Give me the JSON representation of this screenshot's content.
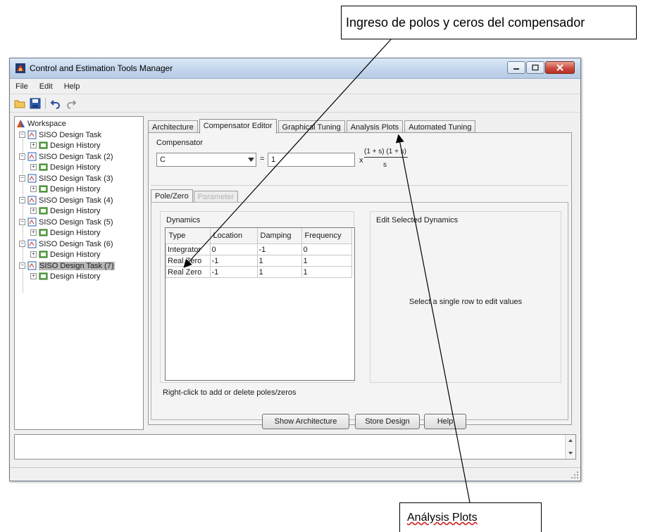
{
  "annotations": {
    "top": "Ingreso de polos y ceros del compensador",
    "bottom": "Análysis Plots"
  },
  "window": {
    "title": "Control and Estimation Tools Manager"
  },
  "menu": [
    "File",
    "Edit",
    "Help"
  ],
  "toolbar": {
    "icons": [
      "open-folder-icon",
      "save-icon",
      "undo-icon",
      "redo-icon"
    ]
  },
  "tree": {
    "root": "Workspace",
    "tasks": [
      {
        "label": "SISO Design Task",
        "child": "Design History"
      },
      {
        "label": "SISO Design Task (2)",
        "child": "Design History"
      },
      {
        "label": "SISO Design Task (3)",
        "child": "Design History"
      },
      {
        "label": "SISO Design Task (4)",
        "child": "Design History"
      },
      {
        "label": "SISO Design Task (5)",
        "child": "Design History"
      },
      {
        "label": "SISO Design Task (6)",
        "child": "Design History"
      },
      {
        "label": "SISO Design Task (7)",
        "child": "Design History",
        "selected": true
      }
    ]
  },
  "tabs": [
    "Architecture",
    "Compensator Editor",
    "Graphical Tuning",
    "Analysis Plots",
    "Automated Tuning"
  ],
  "active_tab": "Compensator Editor",
  "compensator": {
    "title": "Compensator",
    "select_value": "C",
    "equals": "=",
    "gain": "1",
    "times": "x",
    "numerator": "(1 + s) (1 + s)",
    "denominator": "s"
  },
  "subtabs": [
    "Pole/Zero",
    "Parameter"
  ],
  "dynamics": {
    "title": "Dynamics",
    "headers": [
      "Type",
      "Location",
      "Damping",
      "Frequency"
    ],
    "rows": [
      [
        "Integrator",
        "0",
        "-1",
        "0"
      ],
      [
        "Real Zero",
        "-1",
        "1",
        "1"
      ],
      [
        "Real Zero",
        "-1",
        "1",
        "1"
      ]
    ],
    "hint": "Right-click to add or delete poles/zeros"
  },
  "edit": {
    "title": "Edit Selected Dynamics",
    "message": "Select a single row to edit values"
  },
  "buttons": {
    "show_arch": "Show Architecture",
    "store": "Store Design",
    "help": "Help"
  },
  "colors": {
    "titlebar": "#c3d6ec",
    "close": "#c9463a",
    "wavy_underline": "#d02020"
  }
}
